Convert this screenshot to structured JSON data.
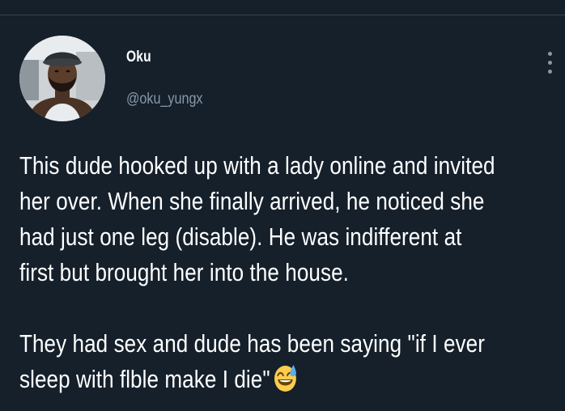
{
  "tweet": {
    "author": {
      "display_name": "Oku",
      "handle": "@oku_yungx"
    },
    "text_lines": [
      "This dude hooked up with a lady online and invited",
      "her over. When she finally arrived, he noticed she",
      "had just one leg (disable). He was indifferent at",
      "first but brought her into the house."
    ],
    "text_lines_2": [
      "They had sex and dude has been saying \"if I ever",
      "sleep with ﬂble make I die\""
    ],
    "emoji": "grinning-face-with-sweat-icon"
  },
  "colors": {
    "background": "#15202b",
    "primary_text": "#ffffff",
    "secondary_text": "#8899a6",
    "divider": "#38444d"
  }
}
